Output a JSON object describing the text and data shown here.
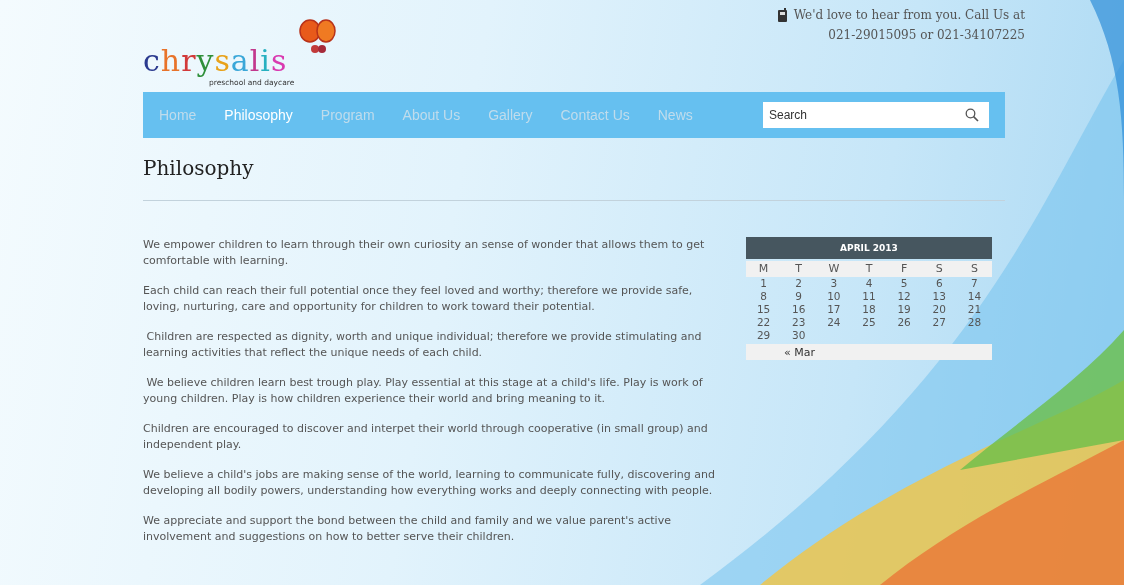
{
  "header": {
    "logo": {
      "name": "chrysalis",
      "tagline": "preschool and daycare"
    },
    "contact": {
      "line1": "We'd love to hear from you. Call Us at",
      "line2": "021-29015095 or 021-34107225"
    }
  },
  "nav": {
    "items": [
      {
        "label": "Home",
        "selected": false
      },
      {
        "label": "Philosophy",
        "selected": true
      },
      {
        "label": "Program",
        "selected": false
      },
      {
        "label": "About Us",
        "selected": false
      },
      {
        "label": "Gallery",
        "selected": false
      },
      {
        "label": "Contact Us",
        "selected": false
      },
      {
        "label": "News",
        "selected": false
      }
    ],
    "search": {
      "placeholder": "Search"
    }
  },
  "page_title": "Philosophy",
  "paragraphs": [
    "We empower children to learn through their own curiosity an sense of wonder that allows them to get comfortable with learning.",
    "Each child can reach their full potential once they feel loved and worthy; therefore we provide safe, loving, nurturing, care and opportunity for children to work toward their potential.",
    " Children are respected as dignity, worth and unique individual; therefore we provide stimulating and learning activities that reflect the unique needs of each child.",
    " We believe children learn best trough play. Play essential at this stage at a child's life. Play is work of young children. Play is how children experience their world and bring meaning to it.",
    "Children are encouraged to discover and interpet their world through cooperative (in small group) and independent play.",
    "We believe a child's jobs are making sense of the world, learning to communicate fully, discovering and developing all bodily powers, understanding how everything works and deeply connecting with people.",
    "We appreciate and support the bond between the child and family and we value parent's active involvement and suggestions on how to better serve their children."
  ],
  "calendar": {
    "title": "APRIL 2013",
    "weekdays": [
      "M",
      "T",
      "W",
      "T",
      "F",
      "S",
      "S"
    ],
    "weeks": [
      [
        "1",
        "2",
        "3",
        "4",
        "5",
        "6",
        "7"
      ],
      [
        "8",
        "9",
        "10",
        "11",
        "12",
        "13",
        "14"
      ],
      [
        "15",
        "16",
        "17",
        "18",
        "19",
        "20",
        "21"
      ],
      [
        "22",
        "23",
        "24",
        "25",
        "26",
        "27",
        "28"
      ],
      [
        "29",
        "30"
      ]
    ],
    "prev_link": "« Mar"
  }
}
